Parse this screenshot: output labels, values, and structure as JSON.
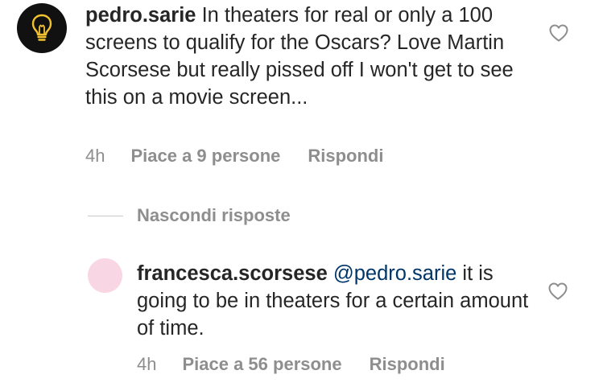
{
  "comment": {
    "username": "pedro.sarie",
    "text": " In theaters for real or only a 100 screens to qualify for the Oscars? Love Martin Scorsese but really pissed off I won't get to see this on a movie screen...",
    "time": "4h",
    "likes": "Piace a 9 persone",
    "reply": "Rispondi",
    "avatar_icon": "lightbulb-icon",
    "avatar_bg": "#111111",
    "avatar_fg": "#f2c230"
  },
  "hide_replies": {
    "label": "Nascondi risposte"
  },
  "reply": {
    "username": "francesca.scorsese",
    "mention": "@pedro.sarie",
    "text": " it is going to be in theaters for a certain amount of time.",
    "time": "4h",
    "likes": "Piace a 56 persone",
    "reply": "Rispondi",
    "avatar_bg": "#f8d6e3"
  },
  "colors": {
    "text": "#262626",
    "muted": "#8e8e8e",
    "mention": "#003569"
  }
}
